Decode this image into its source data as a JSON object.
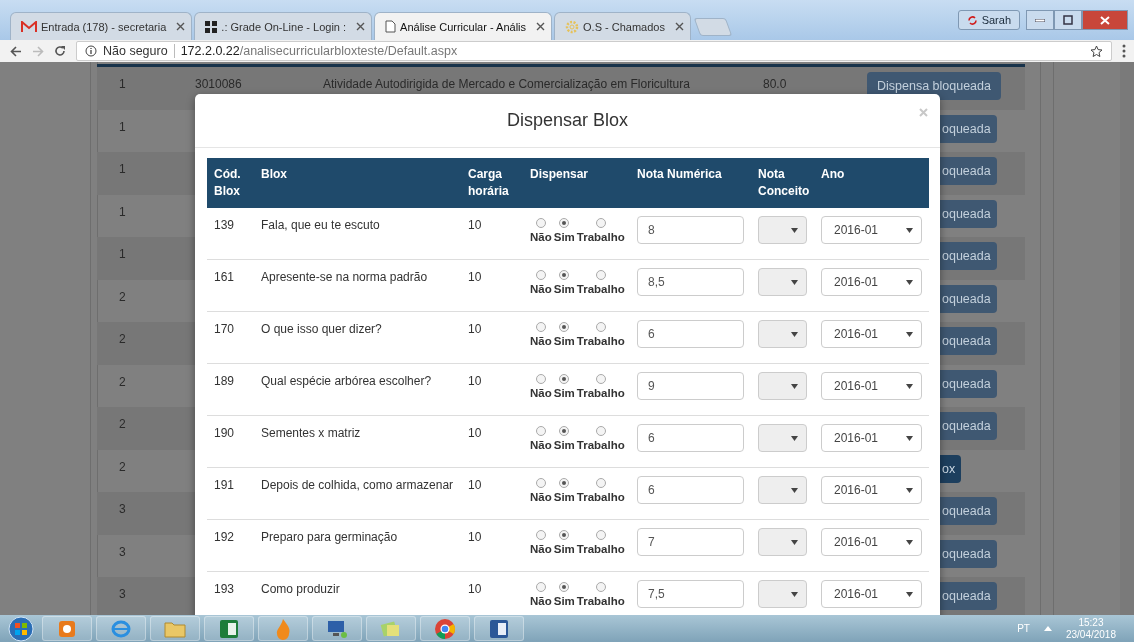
{
  "browser": {
    "tabs": [
      {
        "title": "Entrada (178) - secretaria",
        "selected": false
      },
      {
        "title": ".: Grade On-Line - Login :",
        "selected": false
      },
      {
        "title": "Análise Curricular - Anális",
        "selected": true
      },
      {
        "title": "O.S - Chamados",
        "selected": false
      }
    ],
    "profile": "Sarah",
    "security": "Não seguro",
    "host": "172.2.0.22",
    "path": "/analisecurricularbloxteste/Default.aspx"
  },
  "page_rows": [
    {
      "column_1": "1",
      "code": "3010086",
      "name": "Atividade Autodirigida de Mercado e Comercialização em Floricultura",
      "hours": "80.0",
      "button": {
        "label": "Dispensa bloqueada",
        "kind": "blocked"
      }
    },
    {
      "column_1": "1",
      "button": {
        "label": "oqueada",
        "kind": "blocked"
      }
    },
    {
      "column_1": "1",
      "button": {
        "label": "oqueada",
        "kind": "blocked"
      }
    },
    {
      "column_1": "1",
      "button": {
        "label": "oqueada",
        "kind": "blocked"
      }
    },
    {
      "column_1": "1",
      "button": {
        "label": "oqueada",
        "kind": "blocked"
      }
    },
    {
      "column_1": "2",
      "button": {
        "label": "oqueada",
        "kind": "blocked"
      }
    },
    {
      "column_1": "2",
      "button": {
        "label": "oqueada",
        "kind": "blocked"
      }
    },
    {
      "column_1": "2",
      "button": {
        "label": "oqueada",
        "kind": "blocked"
      }
    },
    {
      "column_1": "2",
      "button": {
        "label": "oqueada",
        "kind": "blocked"
      }
    },
    {
      "column_1": "2",
      "button": {
        "label": "ox",
        "kind": "active"
      }
    },
    {
      "column_1": "3",
      "button": {
        "label": "oqueada",
        "kind": "blocked"
      }
    },
    {
      "column_1": "3",
      "button": {
        "label": "oqueada",
        "kind": "blocked"
      }
    },
    {
      "column_1": "3",
      "button": {
        "label": "oqueada",
        "kind": "blocked"
      }
    }
  ],
  "modal": {
    "title": "Dispensar Blox",
    "columns": [
      "Cód. Blox",
      "Blox",
      "Carga horária",
      "Dispensar",
      "Nota Numérica",
      "Nota Conceito",
      "Ano"
    ],
    "rows": [
      {
        "code": "139",
        "name": "Fala, que eu te escuto",
        "hours": "10",
        "options": [
          {
            "label": "Não",
            "selected": false
          },
          {
            "label": "Sim",
            "selected": true
          },
          {
            "label": "Trabalho",
            "selected": false
          }
        ],
        "grade": "8",
        "concept_disabled": true,
        "year": "2016-01"
      },
      {
        "code": "161",
        "name": "Apresente-se na norma padrão",
        "hours": "10",
        "options": [
          {
            "label": "Não",
            "selected": false
          },
          {
            "label": "Sim",
            "selected": true
          },
          {
            "label": "Trabalho",
            "selected": false
          }
        ],
        "grade": "8,5",
        "concept_disabled": true,
        "year": "2016-01"
      },
      {
        "code": "170",
        "name": "O que isso quer dizer?",
        "hours": "10",
        "options": [
          {
            "label": "Não",
            "selected": false
          },
          {
            "label": "Sim",
            "selected": true
          },
          {
            "label": "Trabalho",
            "selected": false
          }
        ],
        "grade": "6",
        "concept_disabled": true,
        "year": "2016-01"
      },
      {
        "code": "189",
        "name": "Qual espécie arbórea escolher?",
        "hours": "10",
        "options": [
          {
            "label": "Não",
            "selected": false
          },
          {
            "label": "Sim",
            "selected": true
          },
          {
            "label": "Trabalho",
            "selected": false
          }
        ],
        "grade": "9",
        "concept_disabled": true,
        "year": "2016-01"
      },
      {
        "code": "190",
        "name": "Sementes x matriz",
        "hours": "10",
        "options": [
          {
            "label": "Não",
            "selected": false
          },
          {
            "label": "Sim",
            "selected": true
          },
          {
            "label": "Trabalho",
            "selected": false
          }
        ],
        "grade": "6",
        "concept_disabled": true,
        "year": "2016-01"
      },
      {
        "code": "191",
        "name": "Depois de colhida, como armazenar",
        "hours": "10",
        "options": [
          {
            "label": "Não",
            "selected": false
          },
          {
            "label": "Sim",
            "selected": true
          },
          {
            "label": "Trabalho",
            "selected": false
          }
        ],
        "grade": "6",
        "concept_disabled": true,
        "year": "2016-01"
      },
      {
        "code": "192",
        "name": "Preparo para germinação",
        "hours": "10",
        "options": [
          {
            "label": "Não",
            "selected": false
          },
          {
            "label": "Sim",
            "selected": true
          },
          {
            "label": "Trabalho",
            "selected": false
          }
        ],
        "grade": "7",
        "concept_disabled": true,
        "year": "2016-01"
      },
      {
        "code": "193",
        "name": "Como produzir",
        "hours": "10",
        "options": [
          {
            "label": "Não",
            "selected": false
          },
          {
            "label": "Sim",
            "selected": true
          },
          {
            "label": "Trabalho",
            "selected": false
          }
        ],
        "grade": "7,5",
        "concept_disabled": true,
        "year": "2016-01"
      }
    ]
  },
  "taskbar": {
    "language": "PT",
    "time": "15:23",
    "date": "23/04/2018"
  }
}
